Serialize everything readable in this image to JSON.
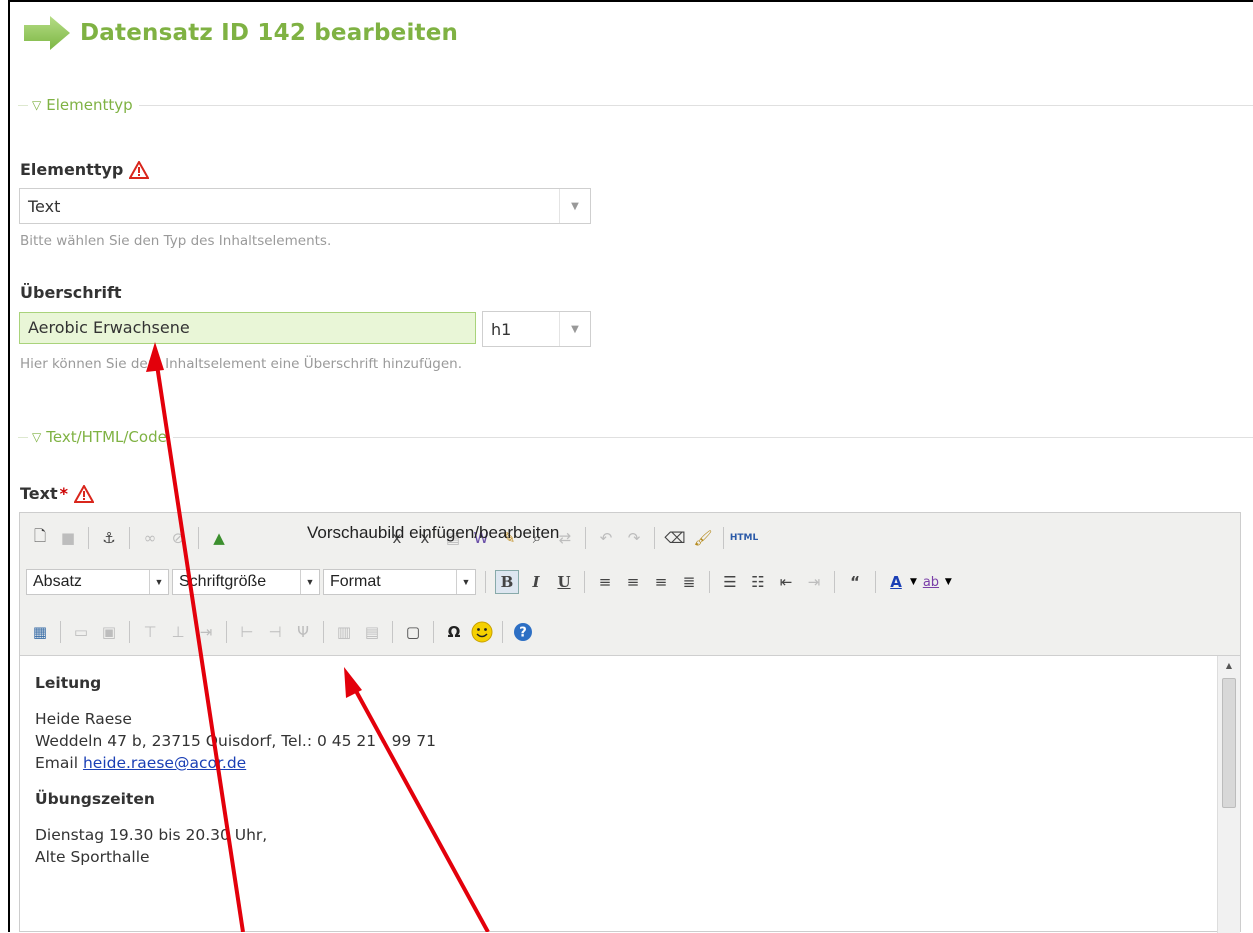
{
  "page": {
    "title": "Datensatz ID 142 bearbeiten"
  },
  "sections": {
    "elementtyp": {
      "legend": "Elementtyp"
    },
    "texthtml": {
      "legend": "Text/HTML/Code"
    }
  },
  "fields": {
    "elementtyp": {
      "label": "Elementtyp",
      "value": "Text",
      "hint": "Bitte wählen Sie den Typ des Inhaltselements."
    },
    "ueberschrift": {
      "label": "Überschrift",
      "value": "Aerobic Erwachsene",
      "level": "h1",
      "hint": "Hier können Sie dem Inhaltselement eine Überschrift hinzufügen."
    },
    "text": {
      "label": "Text",
      "required_mark": "*"
    }
  },
  "editor": {
    "tooltip": "Vorschaubild einfügen/bearbeiten",
    "html_button": "HTML",
    "selects": {
      "paragraph": "Absatz",
      "fontsize": "Schriftgröße",
      "format": "Format"
    },
    "format_buttons": {
      "bold": "B",
      "italic": "I",
      "underline": "U"
    },
    "content": {
      "heading1": "Leitung",
      "name": "Heide Raese",
      "address": "Weddeln 47 b, 23715 Quisdorf, Tel.: 0 45 21 - 99 71",
      "email_label": "Email",
      "email": "heide.raese@acor.de",
      "heading2": "Übungszeiten",
      "time": "Dienstag 19.30 bis 20.30 Uhr,",
      "place": "Alte Sporthalle"
    }
  },
  "colors": {
    "accent": "#7fb243",
    "annotation": "#e3000b"
  },
  "icons": {
    "title": "arrow-right-icon",
    "warning": "warning-triangle-icon",
    "legend": "collapse-triangle-icon"
  }
}
